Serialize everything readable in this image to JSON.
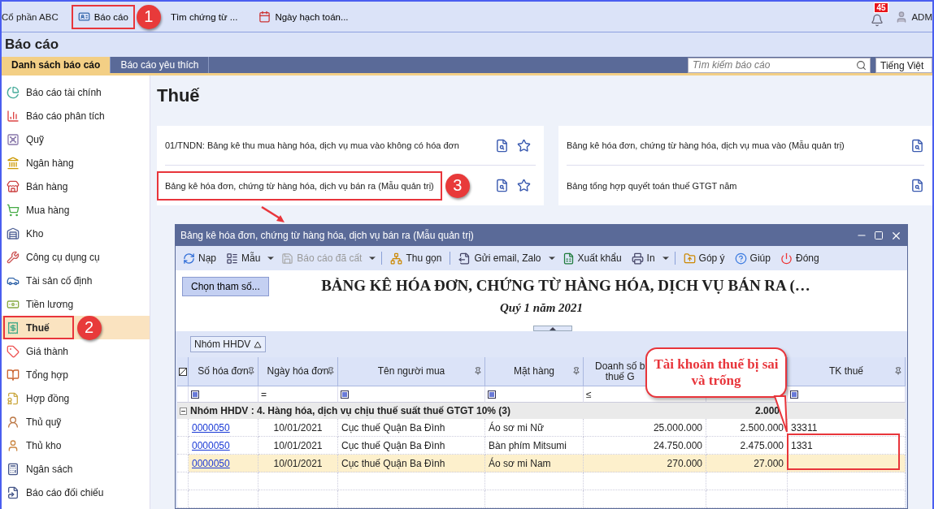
{
  "top_bar": {
    "company": "Cổ phần ABC",
    "buttons": [
      {
        "label": "Báo cáo",
        "highlighted": true,
        "step": "1"
      },
      {
        "label": "Tìm chứng từ ...",
        "highlighted": false
      },
      {
        "label": "Ngày hạch toán...",
        "highlighted": false
      }
    ],
    "notifications": "45",
    "user": "ADM"
  },
  "page_title": "Báo cáo",
  "tabs": [
    {
      "label": "Danh sách báo cáo",
      "selected": true
    },
    {
      "label": "Báo cáo yêu thích",
      "selected": false
    }
  ],
  "search": {
    "placeholder": "Tìm kiếm báo cáo"
  },
  "language": "Tiếng Việt",
  "sidebar": {
    "items": [
      {
        "label": "Báo cáo tài chính",
        "selected": false,
        "highlighted": false
      },
      {
        "label": "Báo cáo phân tích",
        "selected": false,
        "highlighted": false
      },
      {
        "label": "Quỹ",
        "selected": false,
        "highlighted": false
      },
      {
        "label": "Ngân hàng",
        "selected": false,
        "highlighted": false
      },
      {
        "label": "Bán hàng",
        "selected": false,
        "highlighted": false
      },
      {
        "label": "Mua hàng",
        "selected": false,
        "highlighted": false
      },
      {
        "label": "Kho",
        "selected": false,
        "highlighted": false
      },
      {
        "label": "Công cụ dụng cụ",
        "selected": false,
        "highlighted": false
      },
      {
        "label": "Tài sản cố định",
        "selected": false,
        "highlighted": false
      },
      {
        "label": "Tiền lương",
        "selected": false,
        "highlighted": false
      },
      {
        "label": "Thuế",
        "selected": true,
        "highlighted": true,
        "step": "2"
      },
      {
        "label": "Giá thành",
        "selected": false,
        "highlighted": false
      },
      {
        "label": "Tổng hợp",
        "selected": false,
        "highlighted": false
      },
      {
        "label": "Hợp đồng",
        "selected": false,
        "highlighted": false
      },
      {
        "label": "Thủ quỹ",
        "selected": false,
        "highlighted": false
      },
      {
        "label": "Thủ kho",
        "selected": false,
        "highlighted": false
      },
      {
        "label": "Ngân sách",
        "selected": false,
        "highlighted": false
      },
      {
        "label": "Báo cáo đối chiếu",
        "selected": false,
        "highlighted": false
      }
    ]
  },
  "section_title": "Thuế",
  "report_cards": [
    {
      "reports": [
        {
          "title": "01/TNDN: Bảng kê thu mua hàng hóa, dịch vụ mua vào không có hóa đơn",
          "favorite": false,
          "highlighted": false
        },
        {
          "title": "Bảng kê hóa đơn, chứng từ hàng hóa, dịch vụ bán ra (Mẫu quản trị)",
          "favorite": false,
          "highlighted": true,
          "step": "3"
        }
      ]
    },
    {
      "reports": [
        {
          "title": "Bảng kê hóa đơn, chứng từ hàng hóa, dịch vụ mua vào (Mẫu quản trị)",
          "highlighted": false
        },
        {
          "title": "Bảng tổng hợp quyết toán thuế GTGT năm",
          "highlighted": false
        }
      ]
    }
  ],
  "dialog": {
    "title": "Bảng kê hóa đơn, chứng từ hàng hóa, dịch vụ bán ra (Mẫu quản trị)",
    "toolbar": [
      {
        "label": "Nạp",
        "kind": "button",
        "disabled": false
      },
      {
        "label": "Mẫu",
        "kind": "dropdown",
        "disabled": false
      },
      {
        "label": "Báo cáo đã cất",
        "kind": "dropdown",
        "disabled": true
      },
      {
        "label": "Thu gọn",
        "kind": "button",
        "disabled": false
      },
      {
        "label": "Gửi email, Zalo",
        "kind": "dropdown",
        "disabled": false
      },
      {
        "label": "Xuất khẩu",
        "kind": "button",
        "disabled": false
      },
      {
        "label": "In",
        "kind": "dropdown",
        "disabled": false
      },
      {
        "label": "Góp ý",
        "kind": "button",
        "disabled": false
      },
      {
        "label": "Giúp",
        "kind": "button",
        "disabled": false
      },
      {
        "label": "Đóng",
        "kind": "button",
        "disabled": false
      }
    ],
    "choose_button": "Chọn tham số...",
    "report_title": "BẢNG KÊ HÓA ĐƠN, CHỨNG TỪ HÀNG HÓA, DỊCH VỤ BÁN RA (…",
    "report_subtitle": "Quý 1 năm 2021",
    "group_chip": "Nhóm HHDV",
    "columns": [
      {
        "lines": [
          "Số hóa đơn"
        ],
        "filter": {
          "kind": "box"
        }
      },
      {
        "lines": [
          "Ngày hóa đơn"
        ],
        "filter": {
          "kind": "text",
          "text": "="
        }
      },
      {
        "lines": [
          "Tên người mua"
        ],
        "filter": {
          "kind": "box"
        }
      },
      {
        "lines": [
          "Mặt hàng"
        ],
        "filter": {
          "kind": "box"
        }
      },
      {
        "lines": [
          "Doanh số b",
          "thuế G"
        ],
        "filter": {
          "kind": "text",
          "text": "≤"
        }
      },
      {},
      {
        "lines": [
          "TK thuế"
        ],
        "filter": {
          "kind": "box"
        }
      }
    ],
    "group": {
      "label": "Nhóm HHDV : 4. Hàng hóa, dịch vụ chịu thuế suất thuế GTGT 10% (3)",
      "total": "2.000"
    },
    "rows": [
      {
        "cells": [
          "0000050",
          "10/01/2021",
          "Cục thuế Quận Ba Đình",
          "Áo sơ mi Nữ",
          "25.000.000",
          "2.500.000",
          "33311"
        ],
        "selected": false
      },
      {
        "cells": [
          "0000050",
          "10/01/2021",
          "Cục thuế Quận Ba Đình",
          "Bàn phím Mitsumi",
          "24.750.000",
          "2.475.000",
          "1331"
        ],
        "selected": false
      },
      {
        "cells": [
          "0000050",
          "10/01/2021",
          "Cục thuế Quận Ba Đình",
          "Áo sơ mi Nam",
          "270.000",
          "27.000",
          ""
        ],
        "selected": true
      }
    ],
    "callout": "Tài khoản thuế bị sai và trống"
  }
}
